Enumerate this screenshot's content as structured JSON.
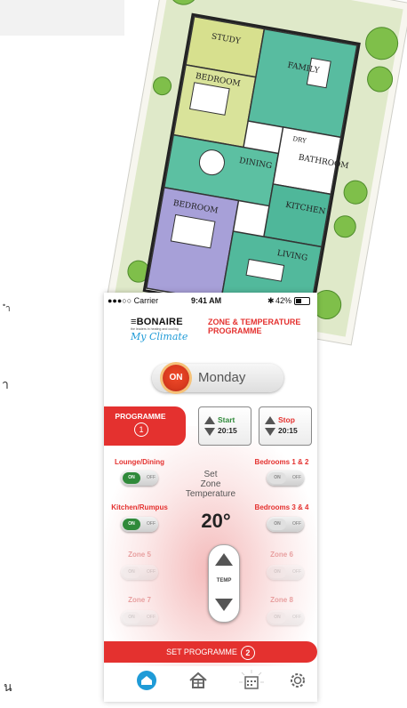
{
  "page_edge_text": {
    "line1": "ำ",
    "line2": "า",
    "line3": "น"
  },
  "status_bar": {
    "carrier": "●●●○○ Carrier",
    "time": "9:41 AM",
    "battery": "42%"
  },
  "logo": {
    "brand": "≡BONAIRE",
    "tagline": "the leaders in heating and cooling",
    "script": "My Climate"
  },
  "header": {
    "title_line1": "ZONE & TEMPERATURE",
    "title_line2": "PROGRAMME"
  },
  "day_selector": {
    "on_label": "ON",
    "day": "Monday"
  },
  "programme_tab": {
    "label": "PROGRAMME",
    "number": "1"
  },
  "start_time": {
    "label": "Start",
    "value": "20:15"
  },
  "stop_time": {
    "label": "Stop",
    "value": "20:15"
  },
  "zones": [
    {
      "name": "Lounge/Dining",
      "state": "ON",
      "off": "OFF"
    },
    {
      "name": "Bedrooms 1 & 2",
      "state": "ON",
      "off": "OFF"
    },
    {
      "name": "Kitchen/Rumpus",
      "state": "ON",
      "off": "OFF"
    },
    {
      "name": "Bedrooms 3 & 4",
      "state": "ON",
      "off": "OFF"
    },
    {
      "name": "Zone 5",
      "state": "ON",
      "off": "OFF"
    },
    {
      "name": "Zone 6",
      "state": "ON",
      "off": "OFF"
    },
    {
      "name": "Zone 7",
      "state": "ON",
      "off": "OFF"
    },
    {
      "name": "Zone 8",
      "state": "ON",
      "off": "OFF"
    }
  ],
  "temperature": {
    "set_line1": "Set",
    "set_line2": "Zone",
    "set_line3": "Temperature",
    "value": "20°",
    "slider_label": "TEMP"
  },
  "set_programme": {
    "label": "SET PROGRAMME",
    "number": "2"
  },
  "floorplan_labels": {
    "study": "STUDY",
    "family": "FAMILY",
    "bedroom1": "BEDROOM",
    "dining": "DINING",
    "bath": "BATHROOM",
    "kitchen": "KITCHEN",
    "bedroom2": "BEDROOM",
    "living": "LIVING",
    "dry": "DRY"
  },
  "colors": {
    "accent": "#e4312f",
    "on_green": "#2f8a3a",
    "tab_active": "#1f9bd7",
    "zone_active_label": "#e4312f",
    "zone_inactive_label": "#e8a0a0"
  },
  "tabs": [
    "home-icon",
    "zones-icon",
    "calendar-icon",
    "settings-icon"
  ]
}
